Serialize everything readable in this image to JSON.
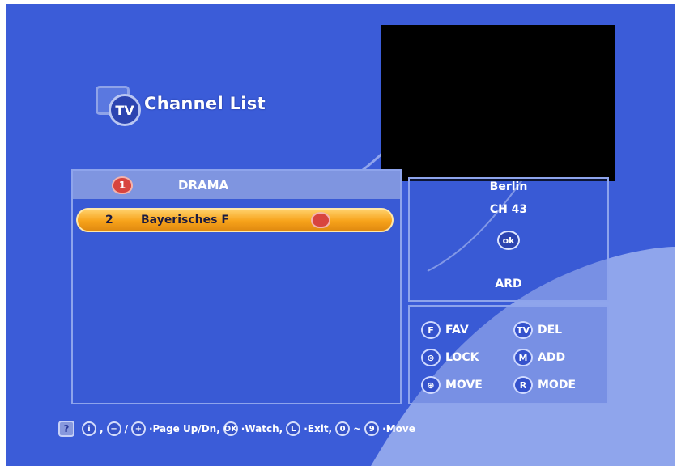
{
  "title": {
    "icon_text": "TV",
    "text": "Channel List"
  },
  "channel_list": {
    "group": {
      "icon_text": "1",
      "name": "DRAMA"
    },
    "rows": [
      {
        "number": "2",
        "name": "Bayerisches F",
        "selected": true,
        "icon": "lock-icon"
      }
    ]
  },
  "info": {
    "location": "Berlin",
    "channel": "CH 43",
    "sat_icon_text": "ok",
    "network": "ARD"
  },
  "keys": [
    {
      "badge": "F",
      "label": "FAV",
      "icon": "fav-key-icon"
    },
    {
      "badge": "TV",
      "label": "DEL",
      "icon": "del-key-icon"
    },
    {
      "badge": "⊙",
      "label": "LOCK",
      "icon": "lock-key-icon"
    },
    {
      "badge": "M",
      "label": "ADD",
      "icon": "add-key-icon"
    },
    {
      "badge": "⊕",
      "label": "MOVE",
      "icon": "move-key-icon"
    },
    {
      "badge": "R",
      "label": "MODE",
      "icon": "mode-key-icon"
    }
  ],
  "footer": {
    "help": "?",
    "b1": "i",
    "sep1": ",",
    "b2": "−",
    "slash": "/",
    "b3": "+",
    "t1": "·Page Up/Dn,",
    "b4": "OK",
    "t2": "·Watch,",
    "b5": "L",
    "t3": "·Exit,",
    "b6": "0",
    "tilde": "~",
    "b7": "9",
    "t4": "·Move"
  },
  "colors": {
    "background": "#3b5cd8",
    "panel_border": "#8ea4ec",
    "selection": "#f7a21a",
    "group_header": "#7f95e0",
    "preview": "#000000"
  }
}
